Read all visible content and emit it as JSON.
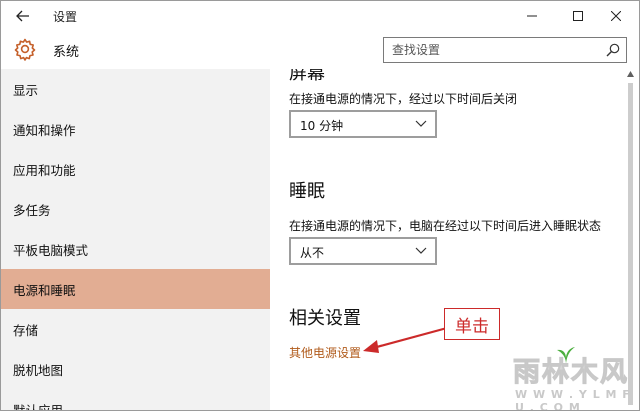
{
  "window": {
    "title": "设置"
  },
  "header": {
    "title": "系统",
    "search_placeholder": "查找设置"
  },
  "sidebar": {
    "items": [
      {
        "label": "显示",
        "active": false
      },
      {
        "label": "通知和操作",
        "active": false
      },
      {
        "label": "应用和功能",
        "active": false
      },
      {
        "label": "多任务",
        "active": false
      },
      {
        "label": "平板电脑模式",
        "active": false
      },
      {
        "label": "电源和睡眠",
        "active": true
      },
      {
        "label": "存储",
        "active": false
      },
      {
        "label": "脱机地图",
        "active": false
      },
      {
        "label": "默认应用",
        "active": false
      }
    ]
  },
  "content": {
    "screen": {
      "heading": "屏幕",
      "description": "在接通电源的情况下，经过以下时间后关闭",
      "selected": "10 分钟"
    },
    "sleep": {
      "heading": "睡眠",
      "description": "在接通电源的情况下，电脑在经过以下时间后进入睡眠状态",
      "selected": "从不"
    },
    "related": {
      "heading": "相关设置",
      "link": "其他电源设置"
    }
  },
  "annotation": {
    "text": "单击",
    "color": "#cc2a2a"
  },
  "watermark": {
    "main": "雨林木风",
    "sub": "W W W . Y L M F U . C O M"
  },
  "colors": {
    "accent_active": "#e2ad93",
    "link": "#b05a1a",
    "gear": "#c5602a"
  }
}
